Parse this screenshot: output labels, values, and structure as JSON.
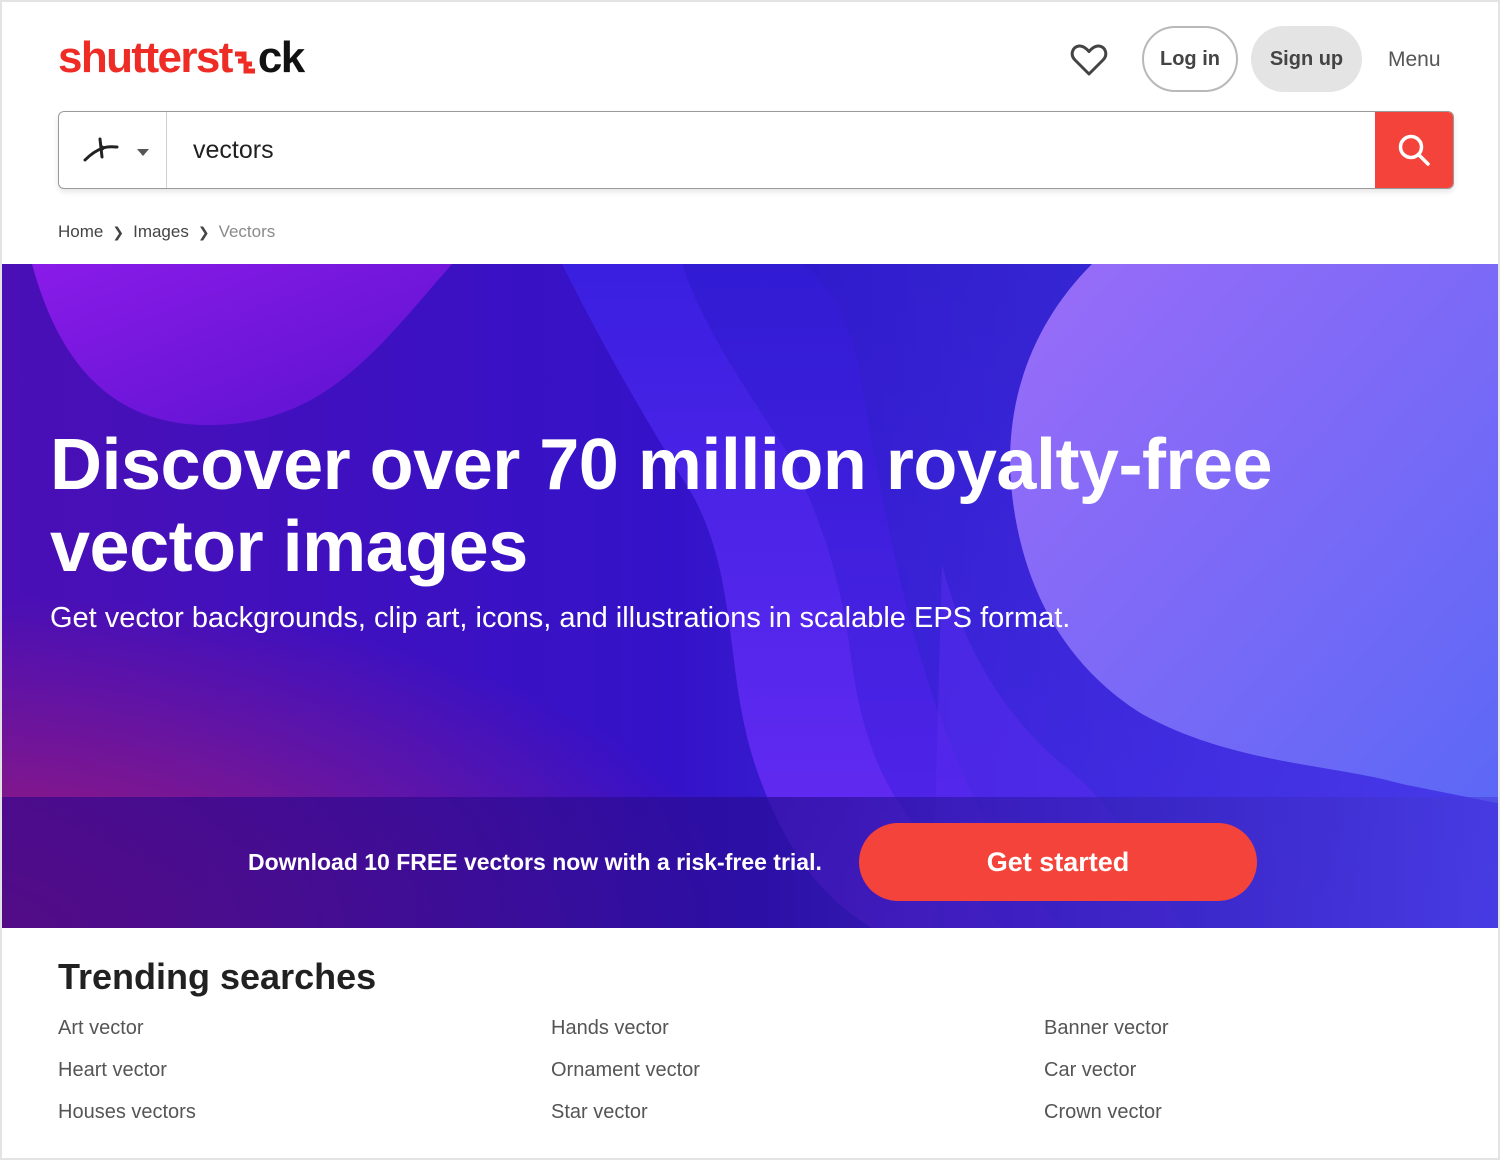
{
  "brand": {
    "logo_part1": "shutterst",
    "logo_part2": "ck",
    "logo_color": "#ee2b24"
  },
  "header": {
    "favorites_icon": "heart-icon",
    "login_label": "Log in",
    "signup_label": "Sign up",
    "menu_label": "Menu"
  },
  "search": {
    "type_icon": "vector-pen-icon",
    "value": "vectors",
    "button_icon": "search-icon",
    "button_color": "#f4433a"
  },
  "breadcrumb": {
    "home": "Home",
    "images": "Images",
    "current": "Vectors"
  },
  "hero": {
    "title_line1": "Discover over 70 million royalty-free",
    "title_line2": "vector images",
    "subtitle": "Get vector backgrounds, clip art, icons, and illustrations in scalable EPS format.",
    "promo_text": "Download 10 FREE vectors now with a risk-free trial.",
    "cta_label": "Get started",
    "cta_color": "#f4433a"
  },
  "trending": {
    "title": "Trending searches",
    "columns": [
      [
        "Art vector",
        "Heart vector",
        "Houses vectors"
      ],
      [
        "Hands vector",
        "Ornament vector",
        "Star vector"
      ],
      [
        "Banner vector",
        "Car vector",
        "Crown vector"
      ]
    ]
  }
}
